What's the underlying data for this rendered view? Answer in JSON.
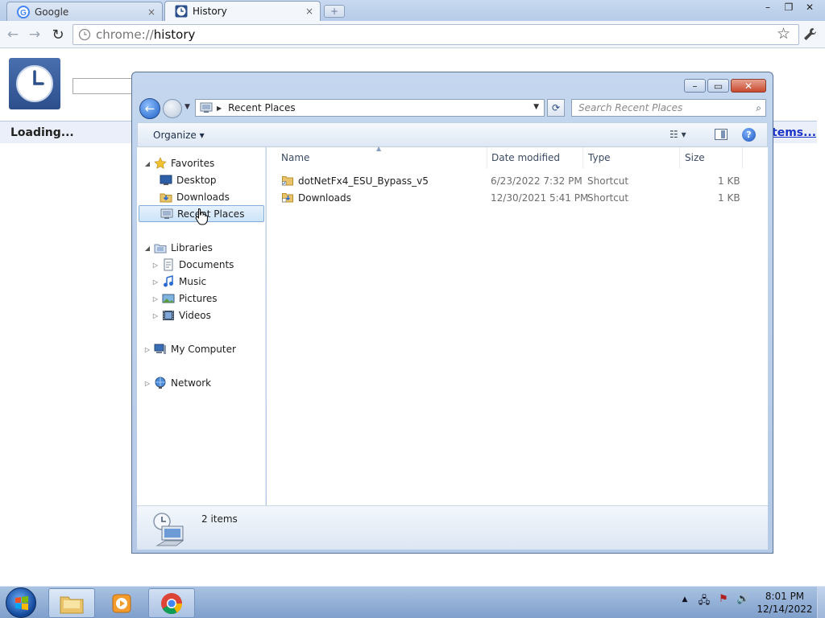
{
  "browser": {
    "tabs": [
      {
        "label": "Google",
        "icon": "google-icon",
        "active": false
      },
      {
        "label": "History",
        "icon": "history-clock-icon",
        "active": true
      }
    ],
    "tab_close_glyph": "×",
    "new_tab_glyph": "+",
    "window_controls": {
      "minimize": "–",
      "maximize": "❐",
      "close": "✕"
    },
    "toolbar": {
      "back_glyph": "←",
      "forward_glyph": "→",
      "reload_glyph": "↻",
      "star_glyph": "☆"
    },
    "omnibox": {
      "scheme": "chrome://",
      "host": "history"
    },
    "page": {
      "loading": "Loading...",
      "link_fragment": "tems..."
    }
  },
  "explorer": {
    "caption": {
      "minimize": "–",
      "maximize": "▭",
      "close": "✕"
    },
    "address": {
      "location": "Recent Places",
      "sep_glyph": "▶",
      "drop_glyph": "▼"
    },
    "refresh_glyph": "⟳",
    "search_placeholder": "Search Recent Places",
    "search_glyph": "⌕",
    "command_bar": {
      "organize": "Organize ▾",
      "views": "☷ ▾",
      "help": "?"
    },
    "nav": [
      {
        "label": "Favorites",
        "level": 0,
        "expander": "◢",
        "icon": "star-icon"
      },
      {
        "label": "Desktop",
        "level": 1,
        "expander": "",
        "icon": "desktop-icon"
      },
      {
        "label": "Downloads",
        "level": 1,
        "expander": "",
        "icon": "downloads-folder-icon"
      },
      {
        "label": "Recent Places",
        "level": 1,
        "expander": "",
        "icon": "recent-places-icon",
        "selected": true
      },
      {
        "label": "Libraries",
        "level": 0,
        "expander": "◢",
        "icon": "libraries-icon"
      },
      {
        "label": "Documents",
        "level": 1,
        "expander": "▷",
        "icon": "documents-icon"
      },
      {
        "label": "Music",
        "level": 1,
        "expander": "▷",
        "icon": "music-icon"
      },
      {
        "label": "Pictures",
        "level": 1,
        "expander": "▷",
        "icon": "pictures-icon"
      },
      {
        "label": "Videos",
        "level": 1,
        "expander": "▷",
        "icon": "videos-icon"
      },
      {
        "label": "My Computer",
        "level": 0,
        "expander": "▷",
        "icon": "computer-icon"
      },
      {
        "label": "Network",
        "level": 0,
        "expander": "▷",
        "icon": "network-icon"
      }
    ],
    "columns": [
      "Name",
      "Date modified",
      "Type",
      "Size"
    ],
    "sort_glyph": "▲",
    "files": [
      {
        "name": "dotNetFx4_ESU_Bypass_v5",
        "date": "6/23/2022 7:32 PM",
        "type": "Shortcut",
        "size": "1 KB",
        "icon": "folder-shortcut-icon"
      },
      {
        "name": "Downloads",
        "date": "12/30/2021 5:41 PM",
        "type": "Shortcut",
        "size": "1 KB",
        "icon": "downloads-shortcut-icon"
      }
    ],
    "status": {
      "count": "2 items"
    }
  },
  "taskbar": {
    "tray": {
      "arrow": "▲",
      "network": "🖧",
      "flag": "⚑",
      "volume": "🔊"
    },
    "clock": {
      "time": "8:01 PM",
      "date": "12/14/2022"
    }
  },
  "colors": {
    "selection": "#cce4f8",
    "link": "#1a33c8",
    "taskbar": "#8fabd4",
    "close_red": "#c94a2f"
  }
}
